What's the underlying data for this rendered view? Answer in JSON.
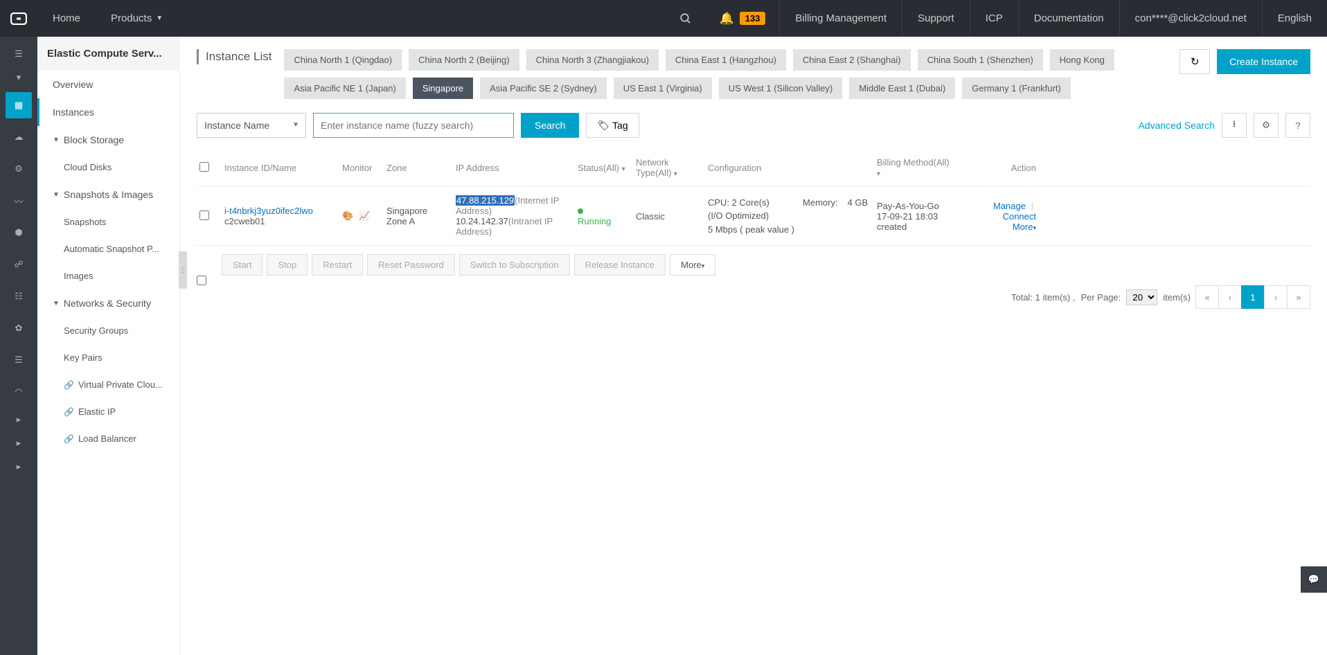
{
  "topnav": {
    "home": "Home",
    "products": "Products",
    "billing": "Billing Management",
    "support": "Support",
    "icp": "ICP",
    "docs": "Documentation",
    "user": "con****@click2cloud.net",
    "lang": "English",
    "notif_count": "133"
  },
  "sidebar": {
    "title": "Elastic Compute Serv...",
    "overview": "Overview",
    "instances": "Instances",
    "block_storage": "Block Storage",
    "cloud_disks": "Cloud Disks",
    "snap_images": "Snapshots & Images",
    "snapshots": "Snapshots",
    "auto_snapshot": "Automatic Snapshot P...",
    "images": "Images",
    "net_sec": "Networks & Security",
    "sec_groups": "Security Groups",
    "key_pairs": "Key Pairs",
    "vpc": "Virtual Private Clou...",
    "eip": "Elastic IP",
    "lb": "Load Balancer"
  },
  "page": {
    "title": "Instance List",
    "refresh": "↻",
    "create": "Create Instance",
    "regions": [
      "China North 1 (Qingdao)",
      "China North 2 (Beijing)",
      "China North 3 (Zhangjiakou)",
      "China East 1 (Hangzhou)",
      "China East 2 (Shanghai)",
      "China South 1 (Shenzhen)",
      "Hong Kong",
      "Asia Pacific NE 1 (Japan)",
      "Singapore",
      "Asia Pacific SE 2 (Sydney)",
      "US East 1 (Virginia)",
      "US West 1 (Silicon Valley)",
      "Middle East 1 (Dubai)",
      "Germany 1 (Frankfurt)"
    ],
    "active_region_index": 8,
    "search_by": "Instance Name",
    "search_placeholder": "Enter instance name (fuzzy search)",
    "search_btn": "Search",
    "tag_btn": "Tag",
    "advanced": "Advanced Search"
  },
  "table": {
    "headers": {
      "id": "Instance ID/Name",
      "monitor": "Monitor",
      "zone": "Zone",
      "ip": "IP Address",
      "status": "Status(All)",
      "net": "Network Type(All)",
      "config": "Configuration",
      "billing": "Billing Method(All)",
      "action": "Action"
    },
    "row": {
      "id_prefix": "i-",
      "id_rest": "t4nbrkj3yuz0ifec2lwo",
      "name": "c2cweb01",
      "zone": "Singapore Zone A",
      "internet_ip": "47.88.215.129",
      "internet_note": "(Internet IP Address)",
      "intranet_ip": "10.24.142.37",
      "intranet_note": "(Intranet IP Address)",
      "status": "Running",
      "net": "Classic",
      "cfg_cpu": "CPU: 2 Core(s)",
      "cfg_io": "(I/O Optimized)",
      "cfg_bw": "5 Mbps ( peak value )",
      "cfg_mem_k": "Memory:",
      "cfg_mem_v": "4 GB",
      "bill_plan": "Pay-As-You-Go",
      "bill_time": "17-09-21 18:03",
      "bill_created": "created",
      "act_manage": "Manage",
      "act_connect": "Connect",
      "act_more": "More"
    }
  },
  "bulk": {
    "start": "Start",
    "stop": "Stop",
    "restart": "Restart",
    "reset": "Reset Password",
    "switch": "Switch to Subscription",
    "release": "Release Instance",
    "more": "More"
  },
  "paging": {
    "total": "Total: 1 item(s) ,",
    "perpage": "Per Page:",
    "perpage_val": "20",
    "items": "item(s)",
    "page": "1"
  }
}
